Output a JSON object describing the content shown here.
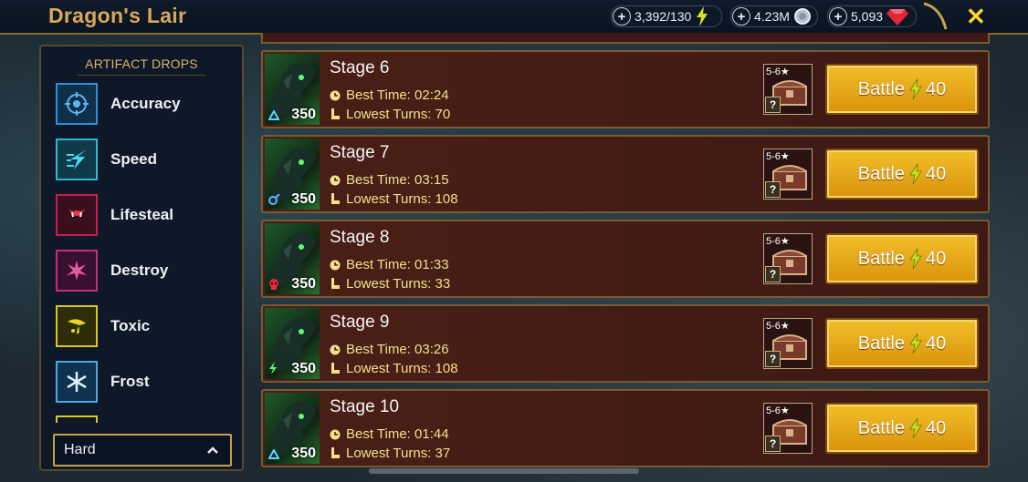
{
  "header": {
    "title": "Dragon's Lair",
    "energy": "3,392/130",
    "silver": "4.23M",
    "gems": "5,093",
    "close_label": "✕"
  },
  "drops": {
    "title": "ARTIFACT DROPS",
    "items": [
      {
        "label": "Accuracy",
        "icon": "accuracy-icon",
        "color": "#2f8fd8"
      },
      {
        "label": "Speed",
        "icon": "speed-icon",
        "color": "#2fb8d8"
      },
      {
        "label": "Lifesteal",
        "icon": "lifesteal-icon",
        "color": "#c8204a"
      },
      {
        "label": "Destroy",
        "icon": "destroy-icon",
        "color": "#c0307a"
      },
      {
        "label": "Toxic",
        "icon": "toxic-icon",
        "color": "#d8c820"
      },
      {
        "label": "Frost",
        "icon": "frost-icon",
        "color": "#4aa8e0"
      }
    ],
    "difficulty": "Hard"
  },
  "stages": [
    {
      "name": "Stage 6",
      "best_time": "Best Time: 02:24",
      "lowest_turns": "Lowest Turns: 70",
      "level": "350",
      "rank": "5-6★",
      "battle_label": "Battle",
      "cost": "40",
      "affinity": "magic"
    },
    {
      "name": "Stage 7",
      "best_time": "Best Time: 03:15",
      "lowest_turns": "Lowest Turns: 108",
      "level": "350",
      "rank": "5-6★",
      "battle_label": "Battle",
      "cost": "40",
      "affinity": "spirit"
    },
    {
      "name": "Stage 8",
      "best_time": "Best Time: 01:33",
      "lowest_turns": "Lowest Turns: 33",
      "level": "350",
      "rank": "5-6★",
      "battle_label": "Battle",
      "cost": "40",
      "affinity": "force"
    },
    {
      "name": "Stage 9",
      "best_time": "Best Time: 03:26",
      "lowest_turns": "Lowest Turns: 108",
      "level": "350",
      "rank": "5-6★",
      "battle_label": "Battle",
      "cost": "40",
      "affinity": "void"
    },
    {
      "name": "Stage 10",
      "best_time": "Best Time: 01:44",
      "lowest_turns": "Lowest Turns: 37",
      "level": "350",
      "rank": "5-6★",
      "battle_label": "Battle",
      "cost": "40",
      "affinity": "magic"
    }
  ],
  "colors": {
    "accent": "#f2be2a",
    "gold_text": "#d9a85a",
    "stage_bg": "#4a1f17"
  }
}
